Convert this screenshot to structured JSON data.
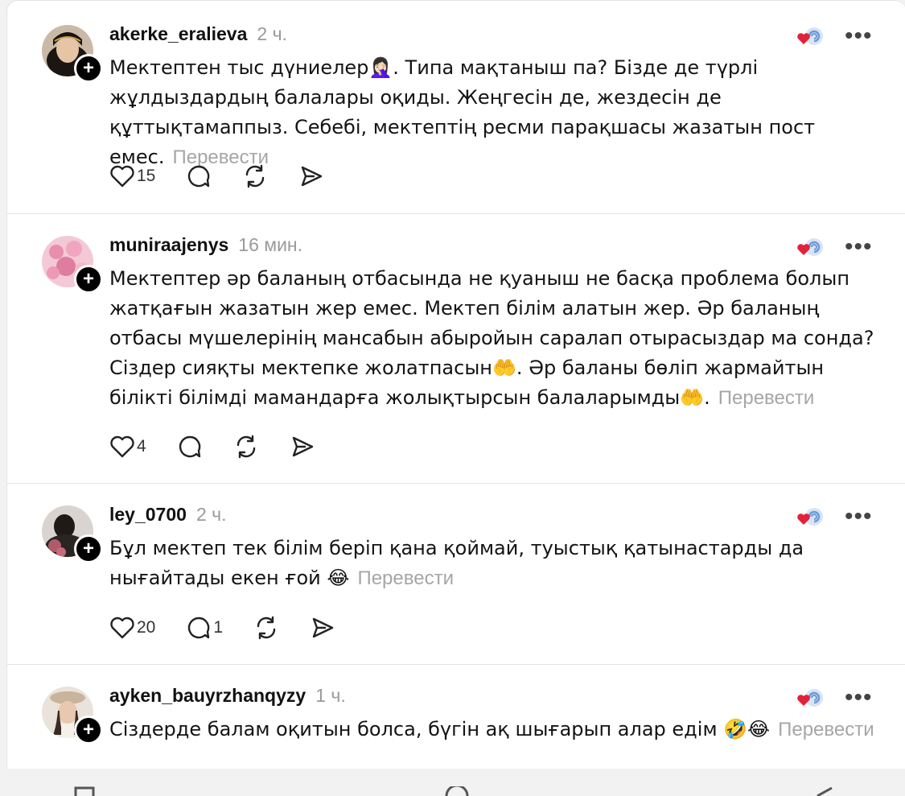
{
  "posts": [
    {
      "username": "akerke_eralieva",
      "time": "2 ч.",
      "text": "Мектептен тыс дүниелер🤦🏻‍♀️. Типа мақтаныш па? Бізде де түрлі жұлдыздардың балалары оқиды. Жеңгесін де, жездесін де құттықтамаппыз. Себебі, мектептің ресми парақшасы жазатын пост емес.",
      "translate": "Перевести",
      "likes": "15",
      "replies": ""
    },
    {
      "username": "muniraajenys",
      "time": "16 мин.",
      "text": "Мектептер әр баланың отбасында не қуаныш не басқа проблема болып жатқағын жазатын жер емес. Мектеп білім алатын жер. Әр баланың отбасы мүшелерінің мансабын абыройын саралап отырасыздар ма сонда? Сіздер сияқты мектепке жолатпасын🤲. Әр баланы бөліп жармайтын білікті білімді мамандарға жолықтырсын балаларымды🤲.",
      "translate": "Перевести",
      "likes": "4",
      "replies": ""
    },
    {
      "username": "ley_0700",
      "time": "2 ч.",
      "text": "Бұл мектеп тек білім беріп қана қоймай, туыстық қатынастарды да нығайтады екен ғой 😂",
      "translate": "Перевести",
      "likes": "20",
      "replies": "1"
    },
    {
      "username": "ayken_bauyrzhanqyzy",
      "time": "1 ч.",
      "text": "Сіздерде балам оқитын болса, бүгін ақ шығарып алар едім 🤣😂",
      "translate": "Перевести"
    }
  ],
  "icons": {
    "like": "heart-icon",
    "reply": "comment-icon",
    "repost": "repost-icon",
    "share": "send-icon",
    "more": "more-icon",
    "follow": "plus-icon"
  },
  "colors": {
    "text": "#141414",
    "muted": "#9a9a9a",
    "badge_red": "#e0233a",
    "badge_blue": "#6d9ad6"
  }
}
